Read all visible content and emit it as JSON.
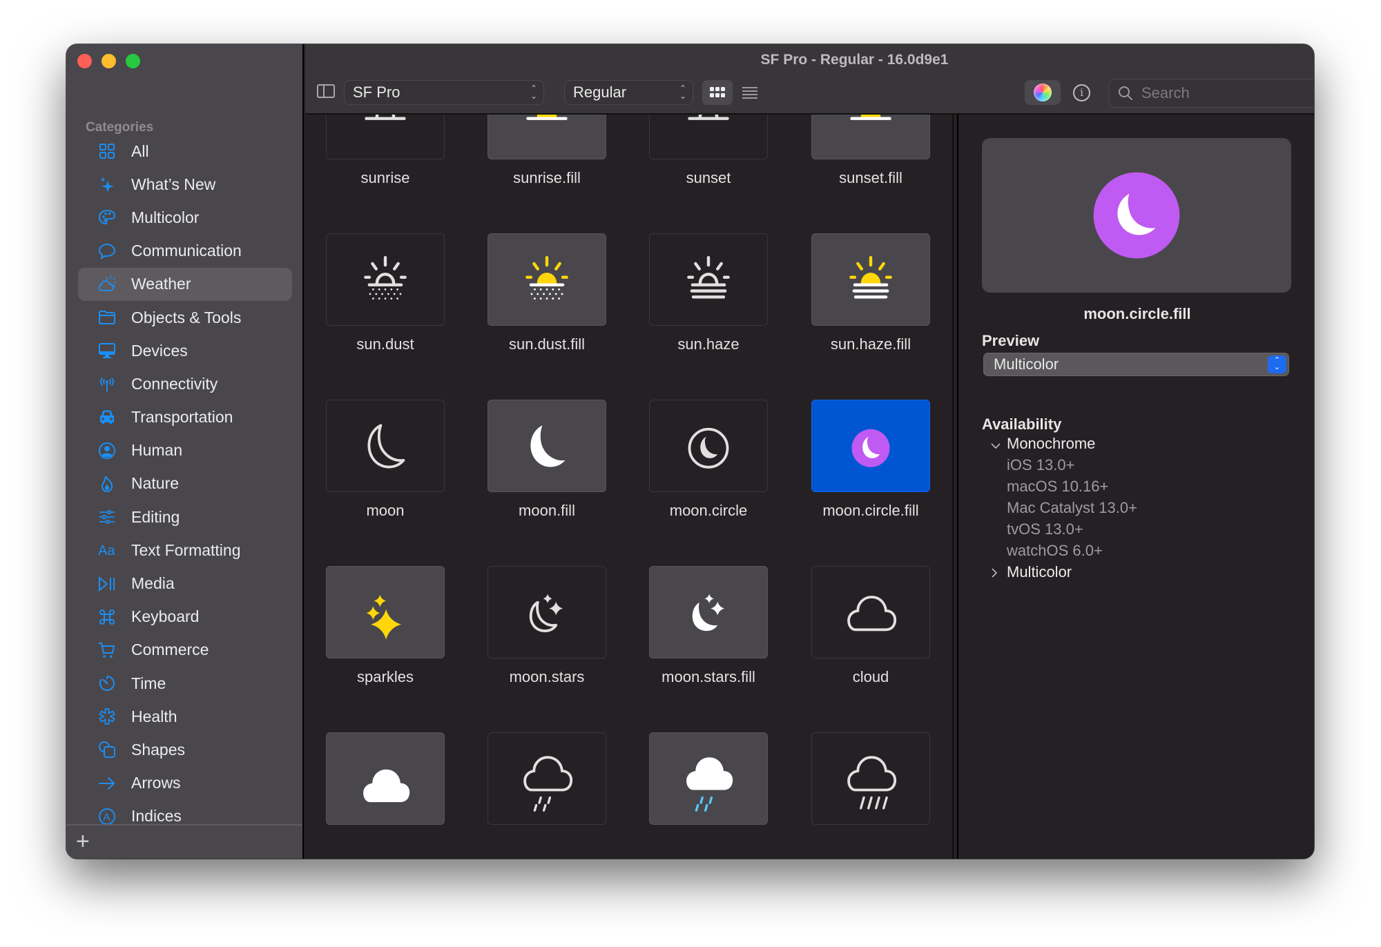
{
  "window": {
    "title": "SF Pro - Regular - 16.0d9e1"
  },
  "sidebar": {
    "header": "Categories",
    "items": [
      {
        "label": "All",
        "icon": "square-grid-icon"
      },
      {
        "label": "What’s New",
        "icon": "sparkle-icon"
      },
      {
        "label": "Multicolor",
        "icon": "paintpalette-icon"
      },
      {
        "label": "Communication",
        "icon": "message-bubble-icon"
      },
      {
        "label": "Weather",
        "icon": "cloud-sun-icon",
        "selected": true
      },
      {
        "label": "Objects & Tools",
        "icon": "folder-icon"
      },
      {
        "label": "Devices",
        "icon": "desktopcomputer-icon"
      },
      {
        "label": "Connectivity",
        "icon": "antenna-icon"
      },
      {
        "label": "Transportation",
        "icon": "car-icon"
      },
      {
        "label": "Human",
        "icon": "person-circle-icon"
      },
      {
        "label": "Nature",
        "icon": "flame-icon"
      },
      {
        "label": "Editing",
        "icon": "sliders-icon"
      },
      {
        "label": "Text Formatting",
        "icon": "textformat-icon"
      },
      {
        "label": "Media",
        "icon": "playpause-icon"
      },
      {
        "label": "Keyboard",
        "icon": "command-icon"
      },
      {
        "label": "Commerce",
        "icon": "cart-icon"
      },
      {
        "label": "Time",
        "icon": "timer-icon"
      },
      {
        "label": "Health",
        "icon": "staroflife-icon"
      },
      {
        "label": "Shapes",
        "icon": "shapes-icon"
      },
      {
        "label": "Arrows",
        "icon": "arrow-right-icon"
      },
      {
        "label": "Indices",
        "icon": "a-circle-icon"
      }
    ],
    "add_label": "+"
  },
  "toolbar": {
    "font_family": "SF Pro",
    "font_weight": "Regular",
    "view_mode": "grid",
    "search_placeholder": "Search",
    "search_value": ""
  },
  "grid": {
    "symbols": [
      {
        "name": "sunrise",
        "icon": "sunrise",
        "style": "plain"
      },
      {
        "name": "sunrise.fill",
        "icon": "sunrise.fill",
        "style": "alt"
      },
      {
        "name": "sunset",
        "icon": "sunset",
        "style": "plain"
      },
      {
        "name": "sunset.fill",
        "icon": "sunset.fill",
        "style": "alt"
      },
      {
        "name": "sun.dust",
        "icon": "sun.dust",
        "style": "plain"
      },
      {
        "name": "sun.dust.fill",
        "icon": "sun.dust.fill",
        "style": "alt"
      },
      {
        "name": "sun.haze",
        "icon": "sun.haze",
        "style": "plain"
      },
      {
        "name": "sun.haze.fill",
        "icon": "sun.haze.fill",
        "style": "alt"
      },
      {
        "name": "moon",
        "icon": "moon",
        "style": "plain"
      },
      {
        "name": "moon.fill",
        "icon": "moon.fill",
        "style": "alt"
      },
      {
        "name": "moon.circle",
        "icon": "moon.circle",
        "style": "plain"
      },
      {
        "name": "moon.circle.fill",
        "icon": "moon.circle.fill",
        "style": "selected"
      },
      {
        "name": "sparkles",
        "icon": "sparkles",
        "style": "alt"
      },
      {
        "name": "moon.stars",
        "icon": "moon.stars",
        "style": "plain"
      },
      {
        "name": "moon.stars.fill",
        "icon": "moon.stars.fill",
        "style": "alt"
      },
      {
        "name": "cloud",
        "icon": "cloud",
        "style": "plain"
      },
      {
        "name": "",
        "icon": "cloud.fill",
        "style": "alt"
      },
      {
        "name": "",
        "icon": "cloud.drizzle",
        "style": "plain"
      },
      {
        "name": "",
        "icon": "cloud.drizzle.fill",
        "style": "alt"
      },
      {
        "name": "",
        "icon": "cloud.rain",
        "style": "plain"
      }
    ]
  },
  "inspector": {
    "symbol_name": "moon.circle.fill",
    "preview_title": "Preview",
    "preview_mode": "Multicolor",
    "availability_title": "Availability",
    "groups": [
      {
        "name": "Monochrome",
        "expanded": true,
        "platforms": [
          "iOS 13.0+",
          "macOS 10.16+",
          "Mac Catalyst 13.0+",
          "tvOS 13.0+",
          "watchOS 6.0+"
        ]
      },
      {
        "name": "Multicolor",
        "expanded": false,
        "platforms": []
      }
    ]
  },
  "colors": {
    "accent": "#1b8ef5",
    "selection": "#0055d2",
    "sun_yellow": "#ffd60a",
    "moon_purple": "#bf5af2",
    "rain_blue": "#5ac8fa",
    "glyph": "#e0e0e0"
  }
}
